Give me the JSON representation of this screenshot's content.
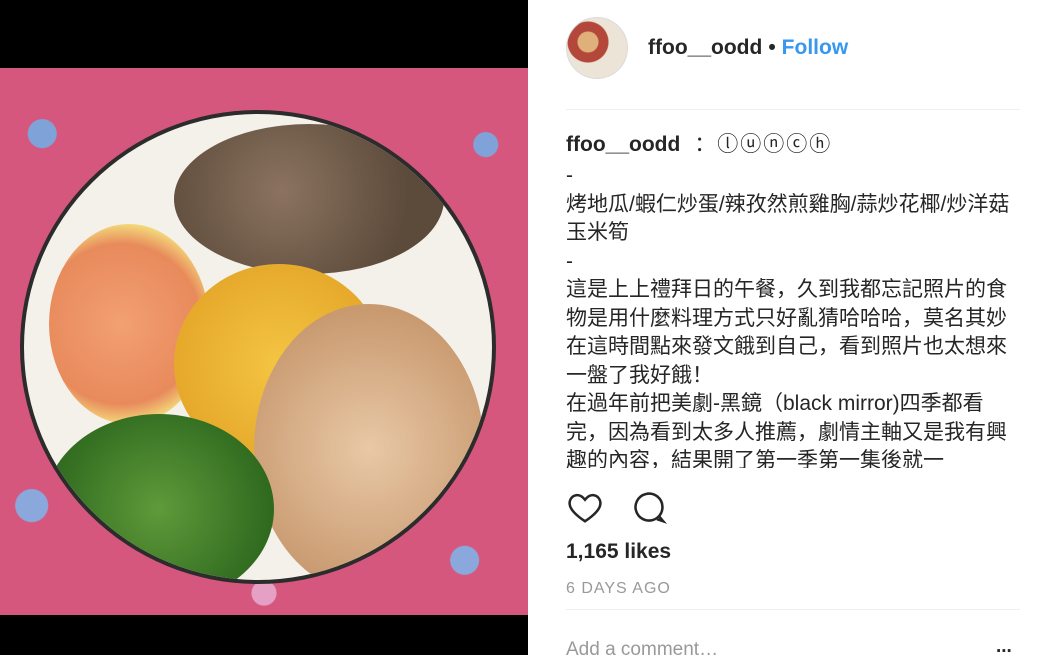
{
  "post": {
    "photo_icon": "food-photo",
    "username": "ffoo__oodd",
    "separator": "•",
    "follow_label": "Follow",
    "caption": {
      "username": "ffoo__oodd",
      "title": "：ⓛⓤⓝⓒⓗ",
      "body": "-\n烤地瓜/蝦仁炒蛋/辣孜然煎雞胸/蒜炒花椰/炒洋菇玉米筍\n-\n這是上上禮拜日的午餐，久到我都忘記照片的食物是用什麼料理方式只好亂猜哈哈哈，莫名其妙在這時間點來發文餓到自己，看到照片也太想來一盤了我好餓！\n在過年前把美劇-黑鏡（black mirror)四季都看完，因為看到太多人推薦，劇情主軸又是我有興趣的內容，結果開了第一季第一集後就一"
    },
    "likes": "1,165 likes",
    "time": "6 DAYS AGO",
    "comment_placeholder": "Add a comment…",
    "more_label": "..."
  },
  "colors": {
    "accent": "#3897f0",
    "muted": "#999999"
  }
}
